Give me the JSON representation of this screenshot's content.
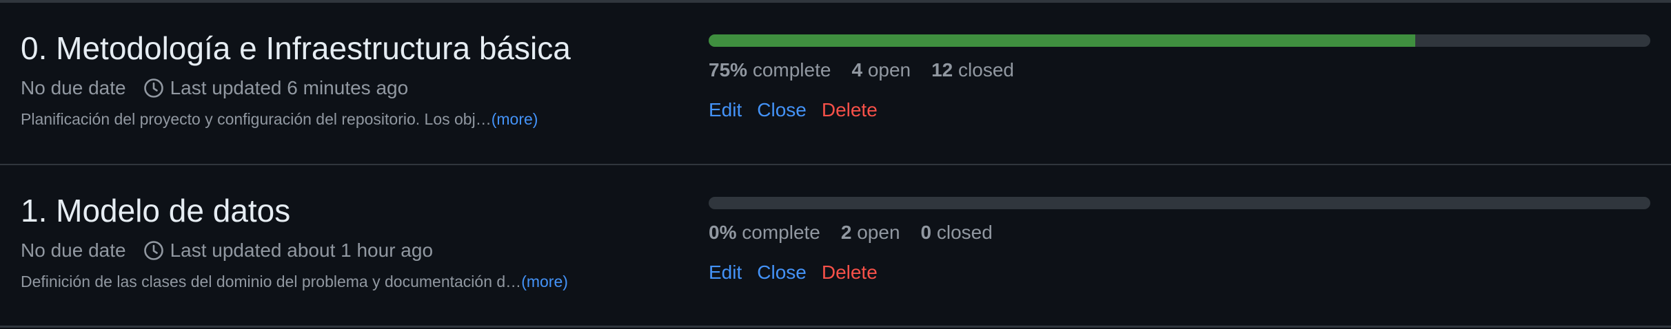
{
  "milestones": [
    {
      "title": "0. Metodología e Infraestructura básica",
      "due": "No due date",
      "updated": "Last updated 6 minutes ago",
      "description": "Planificación del proyecto y configuración del repositorio. Los obj…",
      "more": "(more)",
      "progress": 0.75,
      "percent": "75%",
      "complete_label": "complete",
      "open_count": "4",
      "open_label": "open",
      "closed_count": "12",
      "closed_label": "closed",
      "edit": "Edit",
      "close": "Close",
      "delete": "Delete"
    },
    {
      "title": "1. Modelo de datos",
      "due": "No due date",
      "updated": "Last updated about 1 hour ago",
      "description": "Definición de las clases del dominio del problema y documentación d…",
      "more": "(more)",
      "progress": 0.0,
      "percent": "0%",
      "complete_label": "complete",
      "open_count": "2",
      "open_label": "open",
      "closed_count": "0",
      "closed_label": "closed",
      "edit": "Edit",
      "close": "Close",
      "delete": "Delete"
    }
  ],
  "colors": {
    "progress_fill": "#3f8f3f",
    "progress_track": "#30363d",
    "link": "#4493f8",
    "danger": "#f85149"
  },
  "icons": {
    "updated": "clock-icon"
  }
}
